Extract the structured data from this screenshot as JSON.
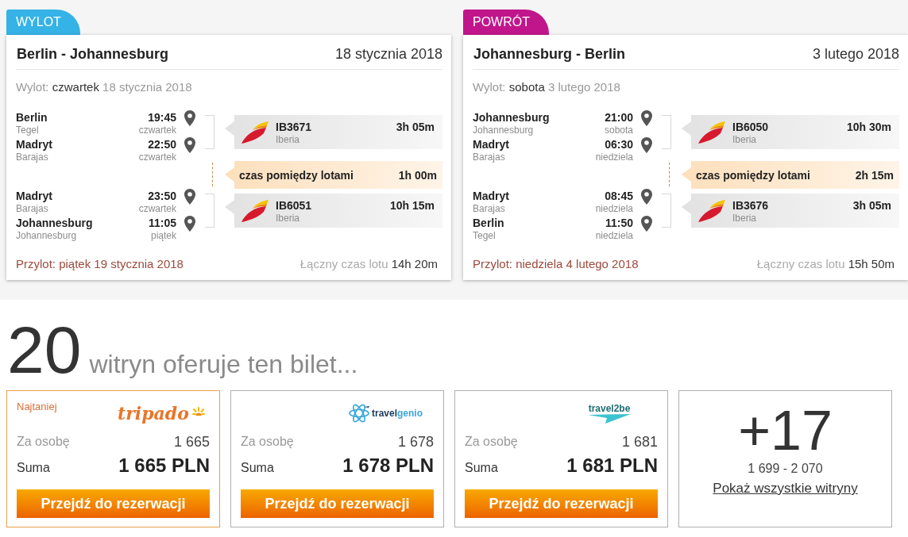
{
  "trips": [
    {
      "direction": "WYLOT",
      "color": "#35b2e6",
      "route": "Berlin - Johannesburg",
      "date": "18 stycznia 2018",
      "departure": {
        "label": "Wylot:",
        "day": "czwartek",
        "date": "18 stycznia 2018"
      },
      "flights": [
        {
          "from": {
            "city": "Berlin",
            "airport": "Tegel",
            "time": "19:45",
            "day": "czwartek"
          },
          "to": {
            "city": "Madryt",
            "airport": "Barajas",
            "time": "22:50",
            "day": "czwartek"
          },
          "number": "IB3671",
          "airline": "Iberia",
          "duration": "3h 05m"
        },
        {
          "from": {
            "city": "Madryt",
            "airport": "Barajas",
            "time": "23:50",
            "day": "czwartek"
          },
          "to": {
            "city": "Johannesburg",
            "airport": "Johannesburg",
            "time": "11:05",
            "day": "piątek"
          },
          "number": "IB6051",
          "airline": "Iberia",
          "duration": "10h 15m"
        }
      ],
      "layovers": [
        {
          "label": "czas pomiędzy lotami",
          "duration": "1h 00m"
        }
      ],
      "arrival": "Przylot: piątek 19 stycznia 2018",
      "total": {
        "label": "Łączny czas lotu",
        "value": "14h 20m"
      }
    },
    {
      "direction": "POWRÓT",
      "color": "#c1168b",
      "route": "Johannesburg - Berlin",
      "date": "3 lutego 2018",
      "departure": {
        "label": "Wylot:",
        "day": "sobota",
        "date": "3 lutego 2018"
      },
      "flights": [
        {
          "from": {
            "city": "Johannesburg",
            "airport": "Johannesburg",
            "time": "21:00",
            "day": "sobota"
          },
          "to": {
            "city": "Madryt",
            "airport": "Barajas",
            "time": "06:30",
            "day": "niedziela"
          },
          "number": "IB6050",
          "airline": "Iberia",
          "duration": "10h 30m"
        },
        {
          "from": {
            "city": "Madryt",
            "airport": "Barajas",
            "time": "08:45",
            "day": "niedziela"
          },
          "to": {
            "city": "Berlin",
            "airport": "Tegel",
            "time": "11:50",
            "day": "niedziela"
          },
          "number": "IB3676",
          "airline": "Iberia",
          "duration": "3h 05m"
        }
      ],
      "layovers": [
        {
          "label": "czas pomiędzy lotami",
          "duration": "2h 15m"
        }
      ],
      "arrival": "Przylot: niedziela 4 lutego 2018",
      "total": {
        "label": "Łączny czas lotu",
        "value": "15h 50m"
      }
    }
  ],
  "heading": {
    "count": "20",
    "text": "witryn oferuje ten bilet..."
  },
  "offers": [
    {
      "highlighted": true,
      "badge": "Najtaniej",
      "logo": {
        "kind": "sun",
        "text": "tripado"
      },
      "per_person_label": "Za osobę",
      "per_person": "1 665",
      "total_label": "Suma",
      "total": "1 665 PLN",
      "button": "Przejdź do rezerwacji"
    },
    {
      "highlighted": false,
      "logo": {
        "kind": "atom",
        "text": "travel",
        "accent": "genio"
      },
      "per_person_label": "Za osobę",
      "per_person": "1 678",
      "total_label": "Suma",
      "total": "1 678 PLN",
      "button": "Przejdź do rezerwacji"
    },
    {
      "highlighted": false,
      "logo": {
        "kind": "plane",
        "text": "travel2be"
      },
      "per_person_label": "Za osobę",
      "per_person": "1 681",
      "total_label": "Suma",
      "total": "1 681 PLN",
      "button": "Przejdź do rezerwacji"
    }
  ],
  "more": {
    "count": "+17",
    "range": "1 699 - 2 070",
    "link": "Pokaż wszystkie witryny"
  }
}
